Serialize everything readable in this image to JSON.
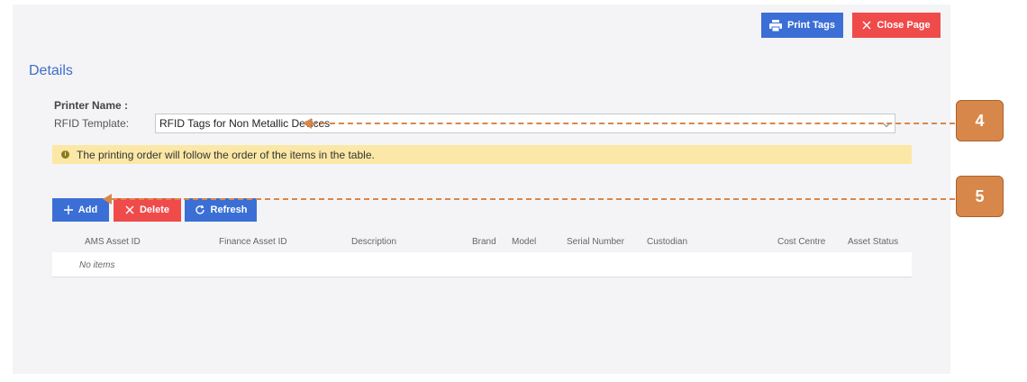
{
  "toolbar": {
    "print_tags_label": "Print Tags",
    "close_page_label": "Close Page"
  },
  "details": {
    "title": "Details",
    "printer_name_label": "Printer Name :",
    "rfid_template_label": "RFID Template:",
    "rfid_template_value": "RFID Tags for Non Metallic Devices",
    "notice": "The printing order will follow the order of the items in the table."
  },
  "table_actions": {
    "add_label": "Add",
    "delete_label": "Delete",
    "refresh_label": "Refresh"
  },
  "table": {
    "columns": [
      "AMS Asset ID",
      "Finance Asset ID",
      "Description",
      "Brand",
      "Model",
      "Serial Number",
      "Custodian",
      "Cost Centre",
      "Asset Status"
    ],
    "empty_text": "No items"
  },
  "callouts": {
    "first": "4",
    "second": "5"
  },
  "colors": {
    "primary": "#3b6fd6",
    "danger": "#ef4b4b",
    "notice_bg": "#fbe8a6",
    "callout": "#d8874a",
    "title": "#3f6cc7"
  }
}
